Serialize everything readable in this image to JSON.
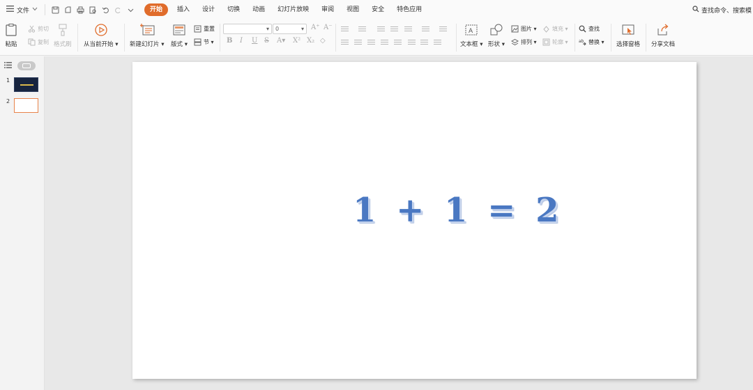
{
  "menubar": {
    "file_label": "文件",
    "tabs": [
      {
        "label": "开始",
        "active": true
      },
      {
        "label": "插入",
        "active": false
      },
      {
        "label": "设计",
        "active": false
      },
      {
        "label": "切换",
        "active": false
      },
      {
        "label": "动画",
        "active": false
      },
      {
        "label": "幻灯片放映",
        "active": false
      },
      {
        "label": "审阅",
        "active": false
      },
      {
        "label": "视图",
        "active": false
      },
      {
        "label": "安全",
        "active": false
      },
      {
        "label": "特色应用",
        "active": false
      }
    ],
    "search_label": "查找命令、搜索模"
  },
  "ribbon": {
    "paste": "粘贴",
    "cut": "剪切",
    "copy": "复制",
    "format_painter": "格式刷",
    "play_from_current": "从当前开始",
    "new_slide": "新建幻灯片",
    "layout": "版式",
    "reset": "重置",
    "section": "节",
    "font_size": "0",
    "textbox": "文本框",
    "shape": "形状",
    "picture": "图片",
    "fill": "填充",
    "arrange": "排列",
    "outline": "轮廓",
    "find": "查找",
    "replace": "替换",
    "selection_pane": "选择窗格",
    "share": "分享文档"
  },
  "thumbnails": [
    {
      "number": "1"
    },
    {
      "number": "2"
    }
  ],
  "slide": {
    "equation": "1 + 1 = 2"
  },
  "colors": {
    "accent": "#e06c2b",
    "equation_text": "#4a78c2"
  }
}
